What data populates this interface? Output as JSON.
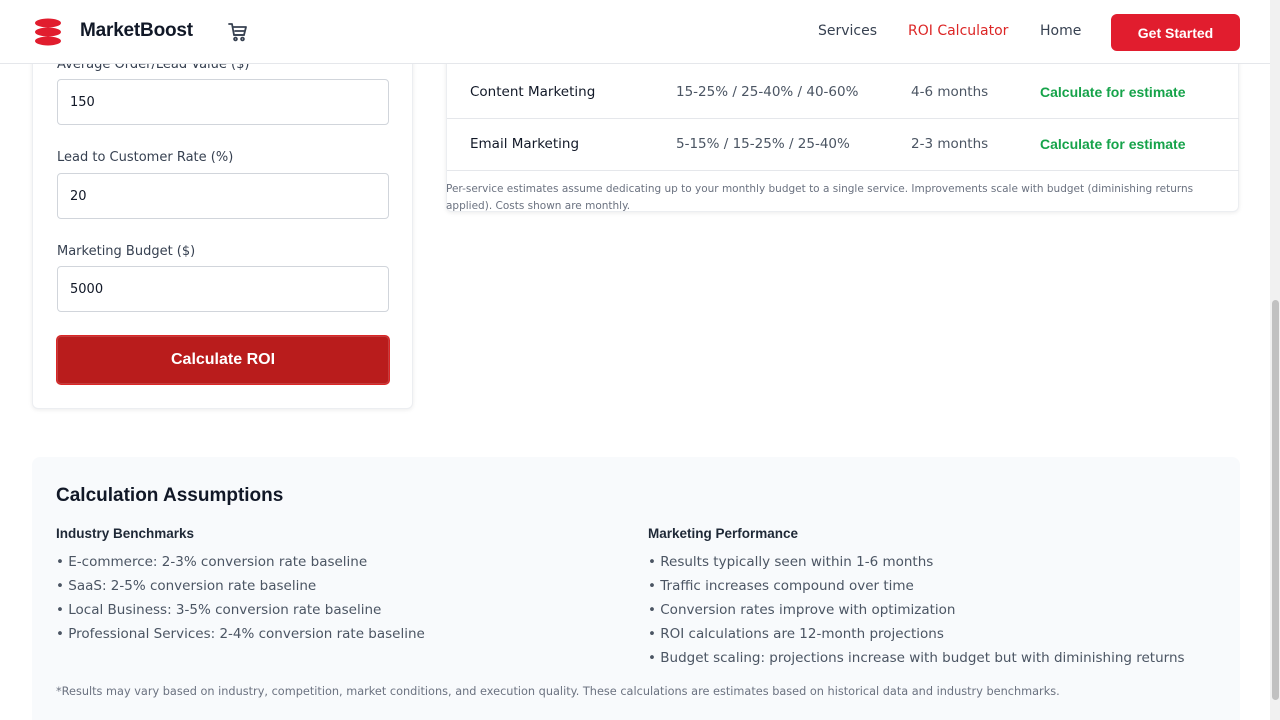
{
  "brand": {
    "name": "MarketBoost",
    "accent": "#e11d2e"
  },
  "header": {
    "logo_icon": "logo-icon",
    "cart_icon": "cart-icon",
    "nav": [
      {
        "label": "Services",
        "active": false
      },
      {
        "label": "ROI Calculator",
        "active": true
      },
      {
        "label": "Home",
        "active": false
      }
    ],
    "cta_label": "Get Started"
  },
  "form": {
    "fields": [
      {
        "label": "Average Order/Lead Value ($)",
        "value": "150"
      },
      {
        "label": "Lead to Customer Rate (%)",
        "value": "20"
      },
      {
        "label": "Marketing Budget ($)",
        "value": "5000"
      }
    ],
    "submit_label": "Calculate ROI"
  },
  "services_table": {
    "rows": [
      {
        "service": "Content Marketing",
        "improvement": "15-25% / 25-40% / 40-60%",
        "timeline": "4-6 months",
        "action": "Calculate for estimate"
      },
      {
        "service": "Email Marketing",
        "improvement": "5-15% / 15-25% / 25-40%",
        "timeline": "2-3 months",
        "action": "Calculate for estimate"
      }
    ],
    "note": "Per-service estimates assume dedicating up to your monthly budget to a single service. Improvements scale with budget (diminishing returns applied). Costs shown are monthly."
  },
  "assumptions": {
    "title": "Calculation Assumptions",
    "industry": {
      "heading": "Industry Benchmarks",
      "items": [
        "• E-commerce: 2-3% conversion rate baseline",
        "• SaaS: 2-5% conversion rate baseline",
        "• Local Business: 3-5% conversion rate baseline",
        "• Professional Services: 2-4% conversion rate baseline"
      ]
    },
    "performance": {
      "heading": "Marketing Performance",
      "items": [
        "• Results typically seen within 1-6 months",
        "• Traffic increases compound over time",
        "• Conversion rates improve with optimization",
        "• ROI calculations are 12-month projections",
        "• Budget scaling: projections increase with budget but with diminishing returns"
      ]
    },
    "footnote": "*Results may vary based on industry, competition, market conditions, and execution quality. These calculations are estimates based on historical data and industry benchmarks."
  }
}
